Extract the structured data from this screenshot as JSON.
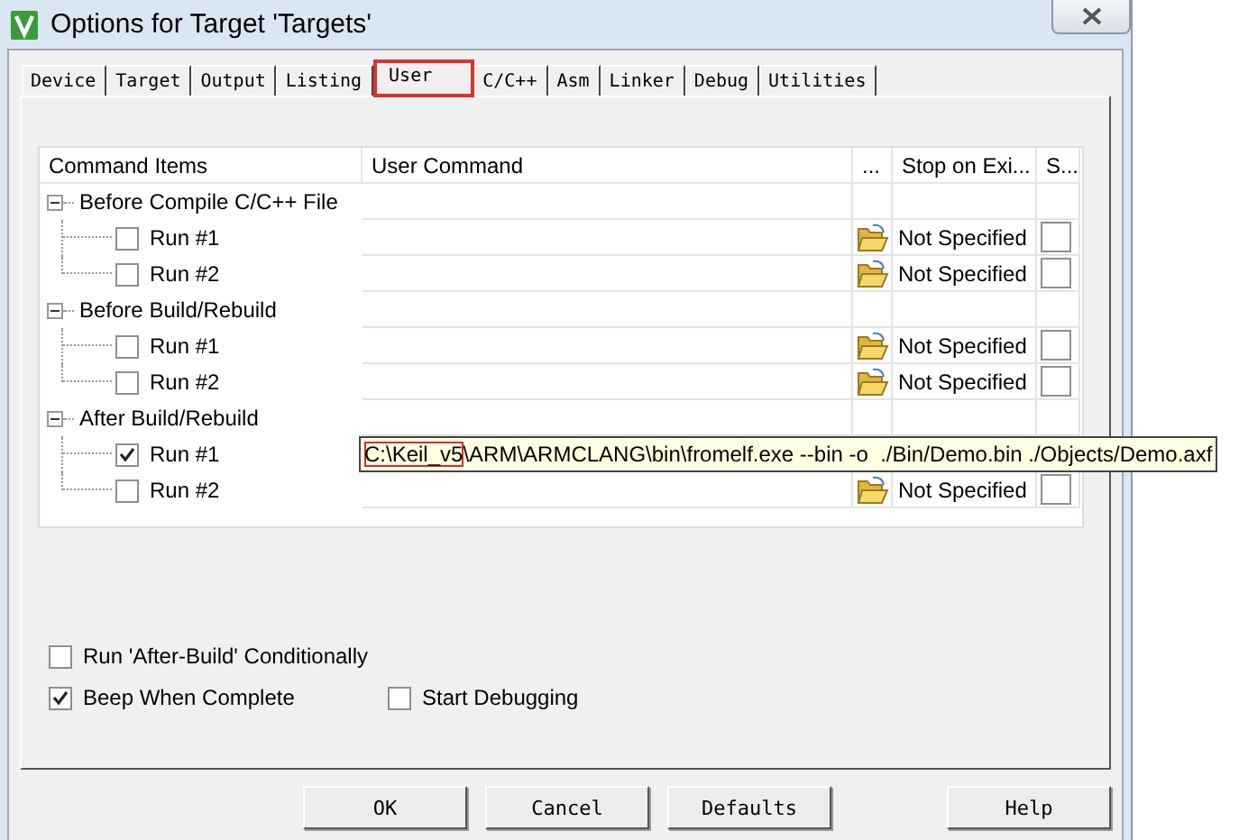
{
  "window": {
    "title": "Options for Target 'Targets'"
  },
  "tabs": [
    {
      "label": "Device",
      "selected": false,
      "highlighted": false
    },
    {
      "label": "Target",
      "selected": false,
      "highlighted": false
    },
    {
      "label": "Output",
      "selected": false,
      "highlighted": false
    },
    {
      "label": "Listing",
      "selected": false,
      "highlighted": false
    },
    {
      "label": "User",
      "selected": true,
      "highlighted": true
    },
    {
      "label": "C/C++",
      "selected": false,
      "highlighted": false
    },
    {
      "label": "Asm",
      "selected": false,
      "highlighted": false
    },
    {
      "label": "Linker",
      "selected": false,
      "highlighted": false
    },
    {
      "label": "Debug",
      "selected": false,
      "highlighted": false
    },
    {
      "label": "Utilities",
      "selected": false,
      "highlighted": false
    }
  ],
  "tree": {
    "columns": [
      "Command Items",
      "User Command",
      "...",
      "Stop on Exi...",
      "S..."
    ],
    "groups": [
      {
        "label": "Before Compile C/C++ File",
        "expanded": true,
        "children": [
          {
            "label": "Run #1",
            "checked": false,
            "stop": "Not Specified",
            "stop_checked": false
          },
          {
            "label": "Run #2",
            "checked": false,
            "stop": "Not Specified",
            "stop_checked": false
          }
        ]
      },
      {
        "label": "Before Build/Rebuild",
        "expanded": true,
        "children": [
          {
            "label": "Run #1",
            "checked": false,
            "stop": "Not Specified",
            "stop_checked": false
          },
          {
            "label": "Run #2",
            "checked": false,
            "stop": "Not Specified",
            "stop_checked": false
          }
        ]
      },
      {
        "label": "After Build/Rebuild",
        "expanded": true,
        "children": [
          {
            "label": "Run #1",
            "checked": true,
            "tooltip": {
              "highlighted": "C:\\Keil_v5",
              "text": "\\ARM\\ARMCLANG\\bin\\fromelf.exe --bin -o  ./Bin/Demo.bin ./Objects/Demo.axf"
            }
          },
          {
            "label": "Run #2",
            "checked": false,
            "stop": "Not Specified",
            "stop_checked": false
          }
        ]
      }
    ]
  },
  "options": [
    {
      "label": "Run 'After-Build' Conditionally",
      "checked": false
    },
    {
      "label": "Beep When Complete",
      "checked": true
    },
    {
      "label": "Start Debugging",
      "checked": false
    }
  ],
  "buttons": [
    "OK",
    "Cancel",
    "Defaults"
  ],
  "help_button": "Help"
}
